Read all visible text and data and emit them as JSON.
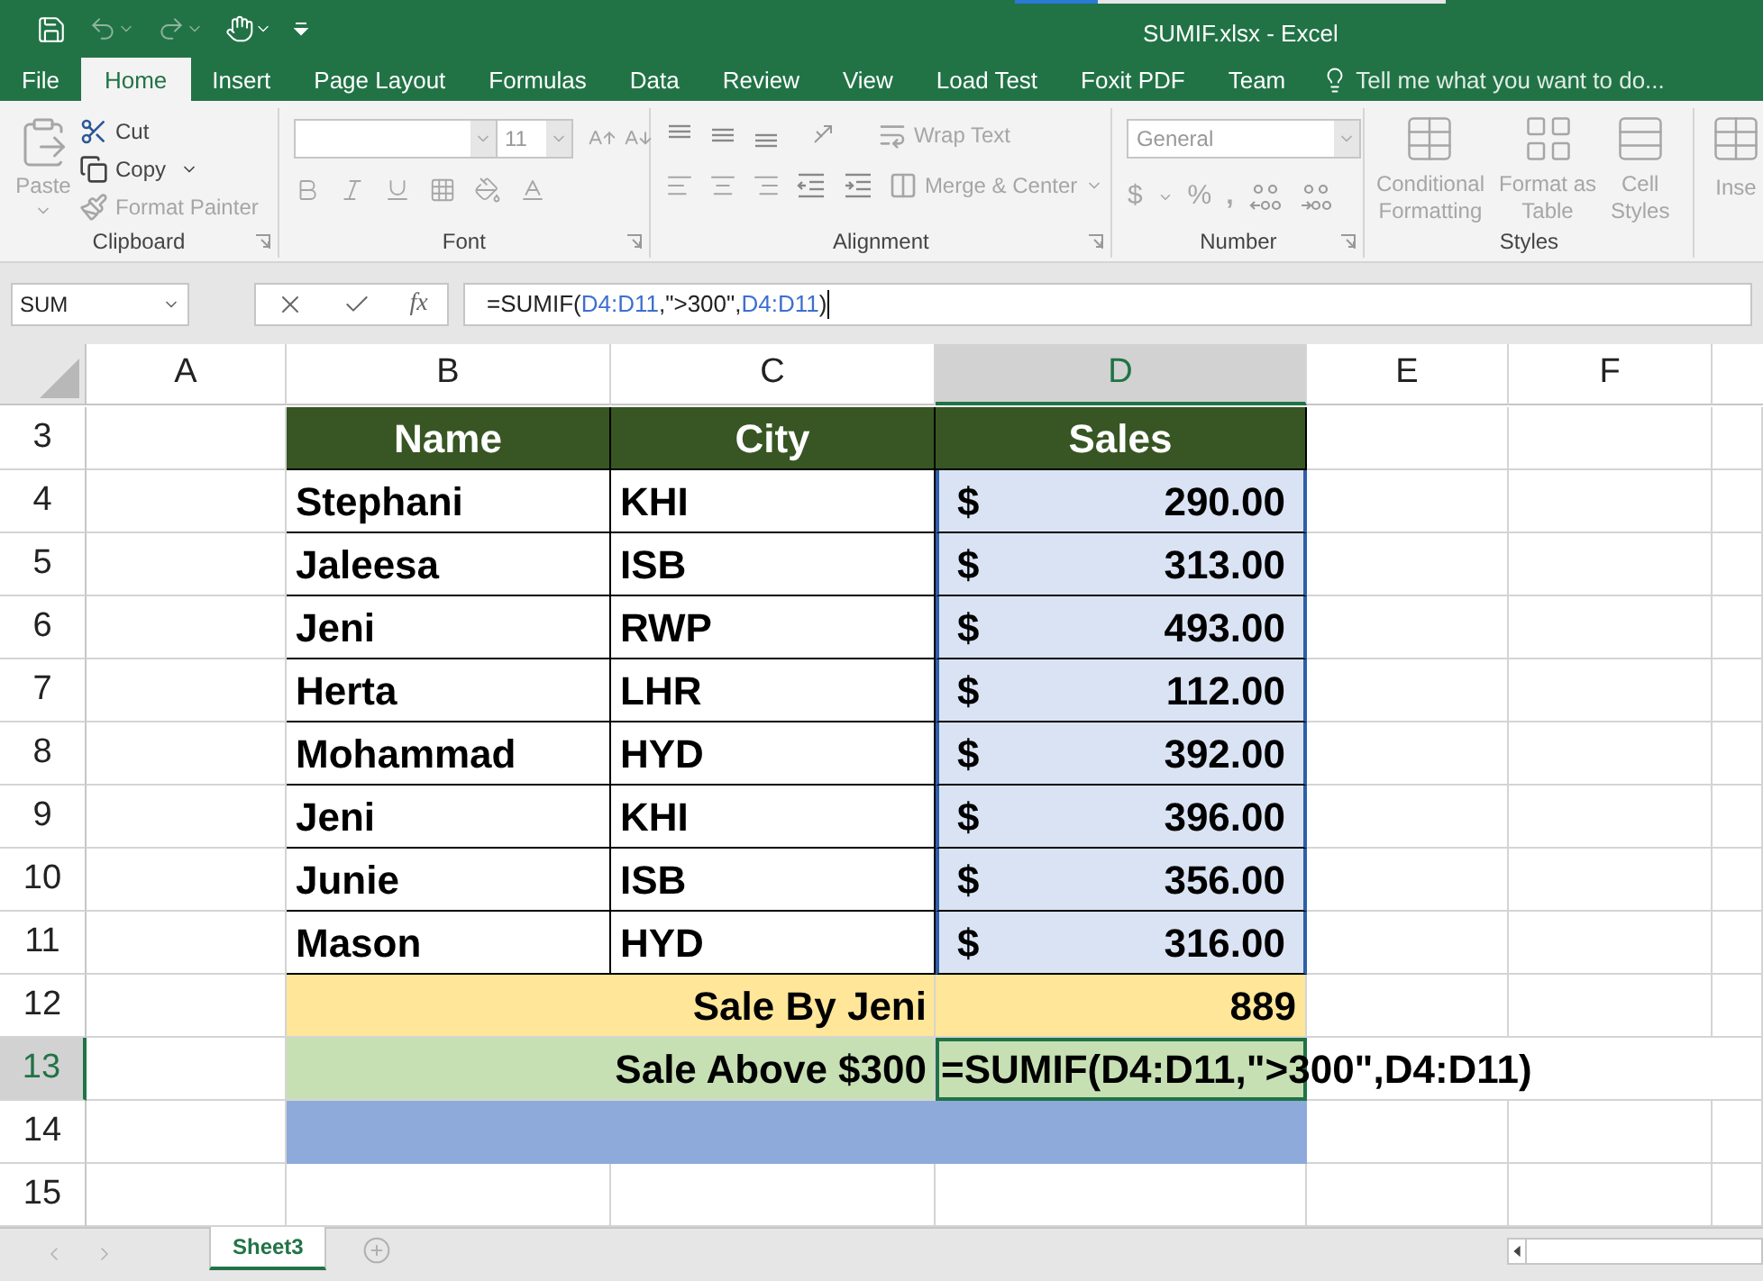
{
  "window": {
    "title": "SUMIF.xlsx - Excel"
  },
  "ribbon_tabs": [
    {
      "label": "File",
      "selected": false
    },
    {
      "label": "Home",
      "selected": true
    },
    {
      "label": "Insert",
      "selected": false
    },
    {
      "label": "Page Layout",
      "selected": false
    },
    {
      "label": "Formulas",
      "selected": false
    },
    {
      "label": "Data",
      "selected": false
    },
    {
      "label": "Review",
      "selected": false
    },
    {
      "label": "View",
      "selected": false
    },
    {
      "label": "Load Test",
      "selected": false
    },
    {
      "label": "Foxit PDF",
      "selected": false
    },
    {
      "label": "Team",
      "selected": false
    }
  ],
  "tell_me": "Tell me what you want to do...",
  "clipboard": {
    "paste": "Paste",
    "cut": "Cut",
    "copy": "Copy",
    "format_painter": "Format Painter",
    "label": "Clipboard"
  },
  "font": {
    "size": "11",
    "label": "Font"
  },
  "alignment": {
    "wrap_text": "Wrap Text",
    "merge_center": "Merge & Center",
    "label": "Alignment"
  },
  "number": {
    "format": "General",
    "currency": "$",
    "percent": "%",
    "comma": ",",
    "label": "Number"
  },
  "styles": {
    "buttons": [
      [
        "Conditional",
        "Formatting"
      ],
      [
        "Format as",
        "Table"
      ],
      [
        "Cell",
        "Styles"
      ]
    ],
    "label": "Styles"
  },
  "cells": {
    "insert": "Inse"
  },
  "name_box": "SUM",
  "function_label": "fx",
  "formula": [
    {
      "kind": "text",
      "text": "=SUMIF("
    },
    {
      "kind": "ref",
      "text": "D4:D11"
    },
    {
      "kind": "text",
      "text": ",\">300\","
    },
    {
      "kind": "ref",
      "text": "D4:D11"
    },
    {
      "kind": "text",
      "text": ")"
    }
  ],
  "columns": [
    {
      "label": "A",
      "selected": false
    },
    {
      "label": "B",
      "selected": false
    },
    {
      "label": "C",
      "selected": false
    },
    {
      "label": "D",
      "selected": true
    },
    {
      "label": "E",
      "selected": false
    },
    {
      "label": "F",
      "selected": false
    }
  ],
  "rows": [
    {
      "number": "3",
      "kind": "header",
      "selected": false,
      "cells": [
        "Name",
        "City",
        "Sales"
      ]
    },
    {
      "number": "4",
      "kind": "data",
      "selected": false,
      "cells": [
        "Stephani",
        "KHI",
        "$",
        "290.00"
      ]
    },
    {
      "number": "5",
      "kind": "data",
      "selected": false,
      "cells": [
        "Jaleesa",
        "ISB",
        "$",
        "313.00"
      ]
    },
    {
      "number": "6",
      "kind": "data",
      "selected": false,
      "cells": [
        "Jeni",
        "RWP",
        "$",
        "493.00"
      ]
    },
    {
      "number": "7",
      "kind": "data",
      "selected": false,
      "cells": [
        "Herta",
        "LHR",
        "$",
        "112.00"
      ]
    },
    {
      "number": "8",
      "kind": "data",
      "selected": false,
      "cells": [
        "Mohammad",
        "HYD",
        "$",
        "392.00"
      ]
    },
    {
      "number": "9",
      "kind": "data",
      "selected": false,
      "cells": [
        "Jeni",
        "KHI",
        "$",
        "396.00"
      ]
    },
    {
      "number": "10",
      "kind": "data",
      "selected": false,
      "cells": [
        "Junie",
        "ISB",
        "$",
        "356.00"
      ]
    },
    {
      "number": "11",
      "kind": "data",
      "selected": false,
      "cells": [
        "Mason",
        "HYD",
        "$",
        "316.00"
      ]
    },
    {
      "number": "12",
      "kind": "total",
      "selected": false,
      "cells": [
        "Sale By Jeni",
        "889"
      ]
    },
    {
      "number": "13",
      "kind": "formula",
      "selected": true,
      "cells": [
        "Sale Above $300",
        "=SUMIF(D4:D11,\">300\",D4:D11)"
      ]
    },
    {
      "number": "14",
      "kind": "fill",
      "selected": false,
      "cells": []
    },
    {
      "number": "15",
      "kind": "empty",
      "selected": false,
      "cells": []
    }
  ],
  "sheet_tabs": [
    {
      "label": "Sheet3",
      "selected": true
    }
  ]
}
